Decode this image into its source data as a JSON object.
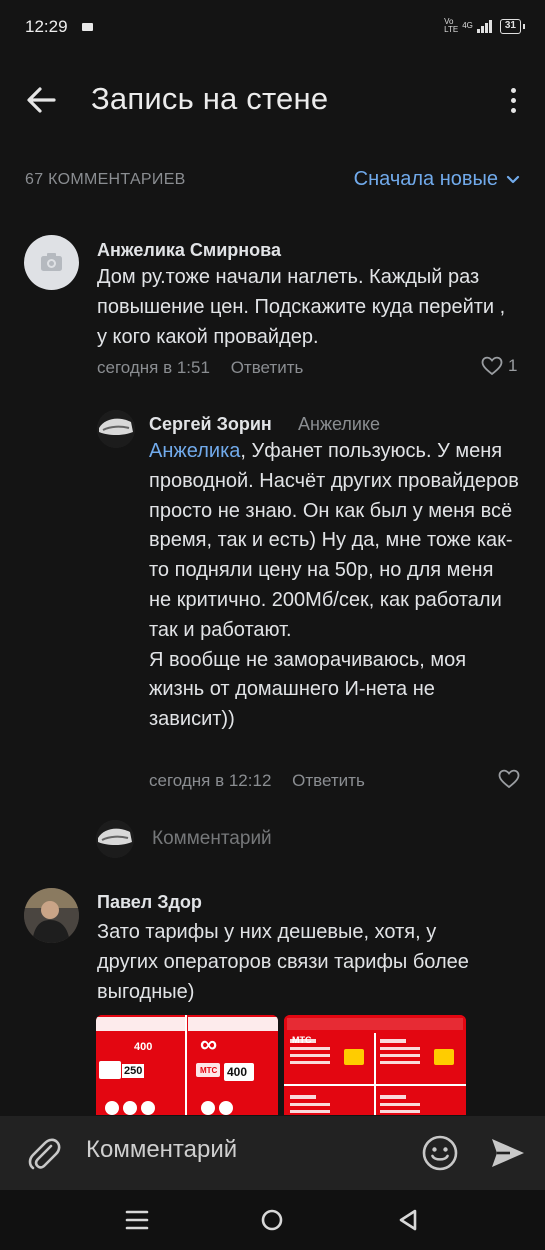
{
  "status_bar": {
    "time": "12:29",
    "net_top": "Vo",
    "net_bottom": "LTE",
    "net_type": "4G",
    "battery": "31"
  },
  "header": {
    "title": "Запись на стене"
  },
  "comments_bar": {
    "count": "67 КОММЕНТАРИЕВ",
    "sort_label": "Сначала новые"
  },
  "comments": [
    {
      "author": "Анжелика Смирнова",
      "text": "Дом ру.тоже начали наглеть. Каждый раз повышение цен. Подскажите куда перейти , у кого какой провайдер.",
      "time": "сегодня в 1:51",
      "reply_label": "Ответить",
      "likes": "1"
    },
    {
      "author": "Сергей Зорин",
      "reply_to": "Анжелике",
      "mention": "Анжелика",
      "text": ", Уфанет пользуюсь. У меня проводной. Насчёт других провайдеров просто не знаю. Он как был у меня всё время, так и есть) Ну да, мне тоже как-то подняли цену на 50р, но для меня не критично. 200Мб/сек, как работали так и работают.",
      "text2": "Я вообще не заморачиваюсь, моя жизнь от домашнего И-нета не зависит))",
      "time": "сегодня в 12:12",
      "reply_label": "Ответить"
    },
    {
      "author": "Павел Здор",
      "text": "Зато тарифы у них дешевые, хотя, у других операторов связи тарифы более выгодные)"
    }
  ],
  "reply_input": {
    "placeholder": "Комментарий"
  },
  "attachments": [
    {
      "label_a": "400",
      "label_b": "250",
      "label_c": "400",
      "brand": "МТС"
    },
    {
      "brand": "МТС"
    }
  ],
  "compose": {
    "placeholder": "Комментарий"
  },
  "colors": {
    "background": "#141414",
    "accent": "#71aaeb",
    "secondary_text": "#8a8d91",
    "mts_red": "#e30611"
  },
  "icons": {
    "back": "arrow-left-icon",
    "more": "more-vertical-icon",
    "sort": "chevron-down-icon",
    "like": "heart-icon",
    "attach": "paperclip-icon",
    "emoji": "smile-icon",
    "send": "send-icon",
    "nav_menu": "menu-icon",
    "nav_home": "home-circle-icon",
    "nav_back": "triangle-back-icon"
  }
}
